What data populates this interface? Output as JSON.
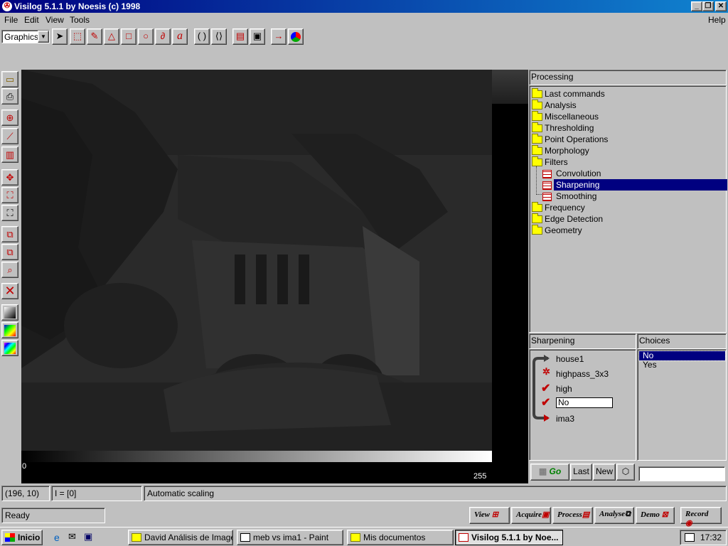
{
  "window": {
    "title": "Visilog 5.1.1 by Noesis (c) 1998"
  },
  "menubar": {
    "file": "File",
    "edit": "Edit",
    "view": "View",
    "tools": "Tools",
    "help": "Help"
  },
  "toolbar": {
    "mode_select": "Graphics",
    "tools": [
      "pointer-icon",
      "rect-select-icon",
      "pencil-icon",
      "polygon-icon",
      "rectangle-icon",
      "circle-icon",
      "freehand-icon",
      "text-icon",
      "bracket-left-icon",
      "bracket-right-icon",
      "open-image-icon",
      "save-image-icon",
      "arrow-x-icon",
      "color-wheel-icon"
    ]
  },
  "viewer": {
    "scale_min": "0",
    "scale_max": "255"
  },
  "processing": {
    "header": "Processing",
    "tree": [
      {
        "label": "Last commands",
        "type": "folder"
      },
      {
        "label": "Analysis",
        "type": "folder"
      },
      {
        "label": "Miscellaneous",
        "type": "folder"
      },
      {
        "label": "Thresholding",
        "type": "folder"
      },
      {
        "label": "Point Operations",
        "type": "folder"
      },
      {
        "label": "Morphology",
        "type": "folder"
      },
      {
        "label": "Filters",
        "type": "folder-open"
      },
      {
        "label": "Convolution",
        "type": "item"
      },
      {
        "label": "Sharpening",
        "type": "item",
        "selected": true
      },
      {
        "label": "Smoothing",
        "type": "item"
      },
      {
        "label": "Frequency",
        "type": "folder"
      },
      {
        "label": "Edge Detection",
        "type": "folder"
      },
      {
        "label": "Geometry",
        "type": "folder"
      }
    ]
  },
  "sharpening": {
    "header": "Sharpening",
    "input": "house1",
    "kernel": "highpass_3x3",
    "mode": "high",
    "option_value": "No",
    "output": "ima3"
  },
  "choices": {
    "header": "Choices",
    "items": [
      "No",
      "Yes"
    ],
    "selected": "No"
  },
  "buttons": {
    "go": "Go",
    "last": "Last",
    "new": "New"
  },
  "status": {
    "coords": "(196, 10)",
    "intensity": "I = [0]",
    "scaling": "Automatic scaling",
    "ready": "Ready"
  },
  "actions": [
    "View",
    "Acquire",
    "Process",
    "Analyse",
    "Demo",
    "Record"
  ],
  "taskbar": {
    "start": "Inicio",
    "tasks": [
      "David Análisis de Imagen",
      "meb vs ima1 - Paint",
      "Mis documentos",
      "Visilog 5.1.1 by Noe..."
    ],
    "clock": "17:32"
  },
  "colors": {
    "titlebar": "#000080",
    "selection": "#000080",
    "accent_red": "#c00000",
    "folder": "#ffff00"
  }
}
